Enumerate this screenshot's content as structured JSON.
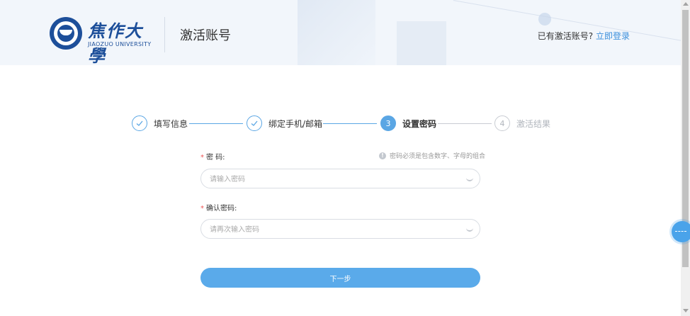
{
  "header": {
    "logo_cn": "焦作大學",
    "logo_en": "JIAOZUO UNIVERSITY",
    "page_title": "激活账号",
    "login_prompt": "已有激活账号?",
    "login_link": "立即登录"
  },
  "steps": [
    {
      "number": "1",
      "label": "填写信息",
      "state": "done"
    },
    {
      "number": "2",
      "label": "绑定手机/邮箱",
      "state": "done"
    },
    {
      "number": "3",
      "label": "设置密码",
      "state": "active"
    },
    {
      "number": "4",
      "label": "激活结果",
      "state": "todo"
    }
  ],
  "form": {
    "password_label": "密 码:",
    "password_hint": "密码必须是包含数字、字母的组合",
    "password_placeholder": "请输入密码",
    "password_value": "",
    "confirm_label": "确认密码:",
    "confirm_placeholder": "请再次输入密码",
    "confirm_value": "",
    "required_mark": "*",
    "next_label": "下一步"
  },
  "icons": {
    "check": "check-icon",
    "info": "info-icon",
    "eye": "eye-closed-icon"
  },
  "colors": {
    "accent": "#5aa6e4",
    "brand": "#1d4f9a",
    "required": "#ee5555"
  }
}
